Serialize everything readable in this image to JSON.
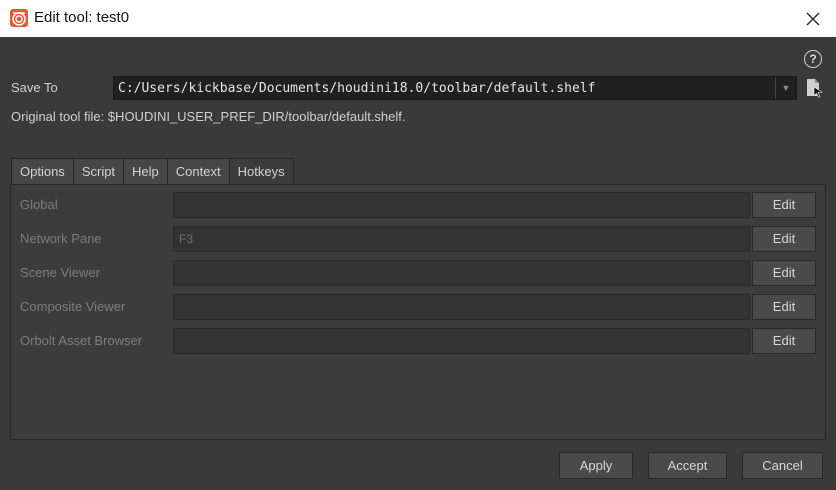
{
  "window": {
    "title": "Edit tool: test0",
    "app_icon": "houdini-logo-icon",
    "close_icon": "close-icon"
  },
  "help": {
    "icon": "help-icon",
    "glyph": "?"
  },
  "save_to": {
    "label": "Save To",
    "value": "C:/Users/kickbase/Documents/houdini18.0/toolbar/default.shelf",
    "dropdown_icon": "dropdown-arrow-icon",
    "file_icon": "file-chooser-icon"
  },
  "original_file": "Original tool file: $HOUDINI_USER_PREF_DIR/toolbar/default.shelf.",
  "tabs": [
    {
      "label": "Options"
    },
    {
      "label": "Script"
    },
    {
      "label": "Help"
    },
    {
      "label": "Context"
    },
    {
      "label": "Hotkeys",
      "active": true
    }
  ],
  "hotkeys": [
    {
      "label": "Global",
      "value": "",
      "edit": "Edit"
    },
    {
      "label": "Network Pane",
      "value": "F3",
      "edit": "Edit"
    },
    {
      "label": "Scene Viewer",
      "value": "",
      "edit": "Edit"
    },
    {
      "label": "Composite Viewer",
      "value": "",
      "edit": "Edit"
    },
    {
      "label": "Orbolt Asset Browser",
      "value": "",
      "edit": "Edit"
    }
  ],
  "buttons": {
    "apply": "Apply",
    "accept": "Accept",
    "cancel": "Cancel"
  },
  "colors": {
    "background": "#3a3a3a",
    "titlebar": "#ffffff",
    "field": "#202020",
    "houdini_orange": "#e8582b"
  }
}
